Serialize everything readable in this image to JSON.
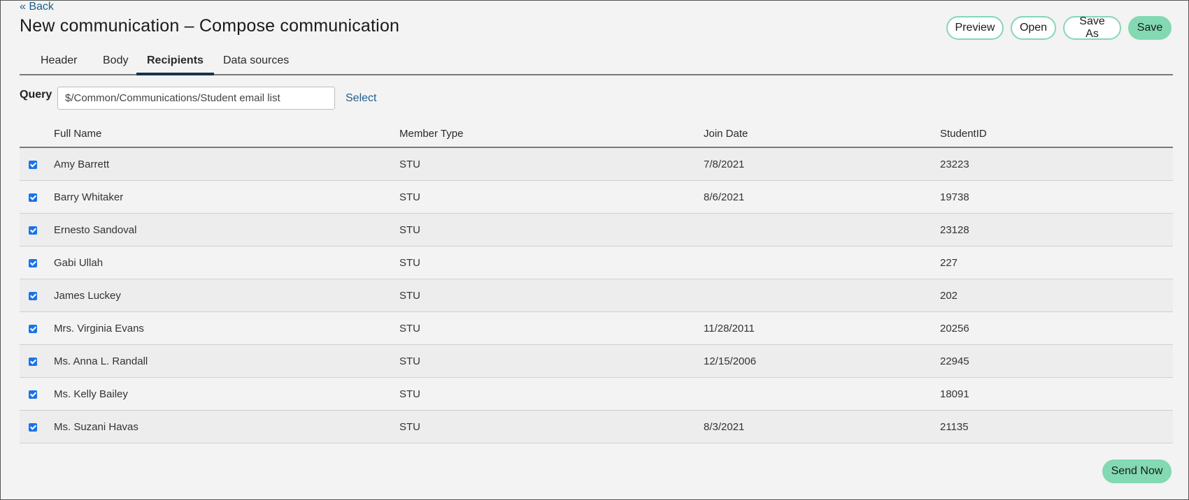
{
  "back_label": "« Back",
  "page_title": "New communication – Compose communication",
  "toolbar": {
    "preview_label": "Preview",
    "open_label": "Open",
    "saveas_label": "Save As",
    "save_label": "Save"
  },
  "tabs": [
    {
      "label": "Header",
      "active": false
    },
    {
      "label": "Body",
      "active": false
    },
    {
      "label": "Recipients",
      "active": true
    },
    {
      "label": "Data sources",
      "active": false
    }
  ],
  "query": {
    "label": "Query",
    "value": "$/Common/Communications/Student email list",
    "select_label": "Select"
  },
  "table": {
    "columns": [
      "Full Name",
      "Member Type",
      "Join Date",
      "StudentID"
    ],
    "rows": [
      {
        "checked": true,
        "name": "Amy Barrett",
        "type": "STU",
        "date": "7/8/2021",
        "id": "23223"
      },
      {
        "checked": true,
        "name": "Barry Whitaker",
        "type": "STU",
        "date": "8/6/2021",
        "id": "19738"
      },
      {
        "checked": true,
        "name": "Ernesto Sandoval",
        "type": "STU",
        "date": "",
        "id": "23128"
      },
      {
        "checked": true,
        "name": "Gabi Ullah",
        "type": "STU",
        "date": "",
        "id": "227"
      },
      {
        "checked": true,
        "name": "James Luckey",
        "type": "STU",
        "date": "",
        "id": "202"
      },
      {
        "checked": true,
        "name": "Mrs. Virginia Evans",
        "type": "STU",
        "date": "11/28/2011",
        "id": "20256"
      },
      {
        "checked": true,
        "name": "Ms. Anna L. Randall",
        "type": "STU",
        "date": "12/15/2006",
        "id": "22945"
      },
      {
        "checked": true,
        "name": "Ms. Kelly Bailey",
        "type": "STU",
        "date": "",
        "id": "18091"
      },
      {
        "checked": true,
        "name": "Ms. Suzani Havas",
        "type": "STU",
        "date": "8/3/2021",
        "id": "21135"
      }
    ]
  },
  "send_label": "Send Now",
  "colors": {
    "accent": "#82d9b2",
    "link": "#1f5f8b",
    "tab_underline": "#16344a",
    "checkbox": "#1a73e8"
  }
}
